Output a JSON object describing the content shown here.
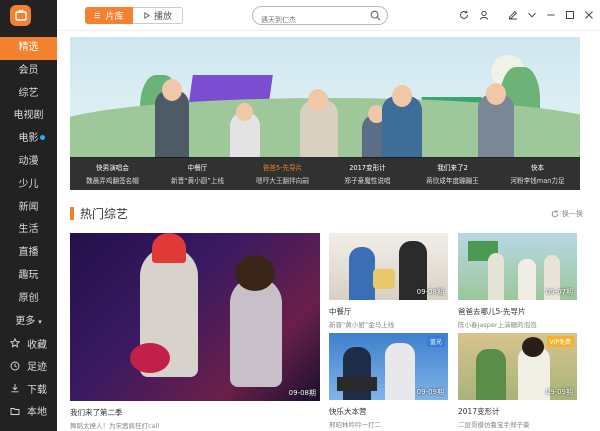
{
  "app": {
    "logo": "app-logo"
  },
  "sidebar": {
    "items": [
      {
        "label": "精选",
        "dot": "orange"
      },
      {
        "label": "会员"
      },
      {
        "label": "综艺"
      },
      {
        "label": "电视剧"
      },
      {
        "label": "电影",
        "dot": "blue"
      },
      {
        "label": "动漫"
      },
      {
        "label": "少儿"
      },
      {
        "label": "新闻"
      },
      {
        "label": "生活"
      },
      {
        "label": "直播"
      },
      {
        "label": "趣玩"
      },
      {
        "label": "原创"
      },
      {
        "label": "更多"
      }
    ],
    "bottom": [
      {
        "label": "收藏",
        "icon": "star-icon"
      },
      {
        "label": "足迹",
        "icon": "clock-icon"
      },
      {
        "label": "下载",
        "icon": "download-icon"
      },
      {
        "label": "本地",
        "icon": "folder-icon"
      }
    ]
  },
  "topbar": {
    "tab_library": "片库",
    "tab_play": "播放",
    "search_placeholder": "遇天到仁杰"
  },
  "banner": {
    "captions": [
      {
        "title": "快男演唱会",
        "sub": "魏晨弄鸡翻签名帽"
      },
      {
        "title": "中餐厅",
        "sub": "新晋“黄小厨”上线"
      },
      {
        "title": "爸爸5-先导片",
        "sub": "嗯哼大王翻拌向嗣"
      },
      {
        "title": "2017变形计",
        "sub": "郑子豪魔性说唱"
      },
      {
        "title": "我们来了2",
        "sub": "蒋欣成年度蹦蹦王"
      },
      {
        "title": "快本",
        "sub": "河粉李钱man力足"
      }
    ],
    "active_index": 2
  },
  "section": {
    "title": "热门综艺",
    "refresh": "换一换"
  },
  "cards": [
    {
      "title": "我们来了第二季",
      "desc": "舞蹈太撩人！为宋茜疯狂打call",
      "ep": "09-08期"
    },
    {
      "title": "中餐厅",
      "desc": "新晋“黄小厨”金马上线",
      "ep": "09-08期"
    },
    {
      "title": "爸爸去哪儿5-先导片",
      "desc": "陈小春Jasper上演糖的泡泡",
      "ep": "09-07期"
    },
    {
      "title": "快乐大本营",
      "desc": "邢昭林吟吟一打二",
      "ep": "09-09期",
      "badge": "蓝光"
    },
    {
      "title": "2017变形计",
      "desc": "二层哥模仿鲁宝手郑子豪",
      "ep": "09-09期",
      "badge": "VIP免费"
    }
  ]
}
